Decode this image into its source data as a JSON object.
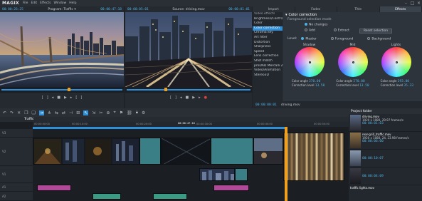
{
  "app": {
    "logo": "MAGIX"
  },
  "menu": [
    "File",
    "Edit",
    "Effects",
    "Window",
    "Help"
  ],
  "window_controls": [
    "–",
    "□",
    "×"
  ],
  "program_monitor": {
    "left_tc": "00:00:26:25",
    "label": "Program: Traffic",
    "dropdown": "▾",
    "right_tc": "00:00:47:18"
  },
  "source_monitor": {
    "left_tc": "00:00:05:01",
    "label": "Source: driving.mov",
    "right_tc": "00:00:01:01"
  },
  "tabs": [
    "Import",
    "Fades",
    "Title",
    "Effects"
  ],
  "video_effects": {
    "header": "Video effects",
    "items": [
      "Brightness/Contrast",
      "Color",
      "Color correction",
      "Chroma key",
      "Art filter",
      "Distortion",
      "Sharpness",
      "Speed",
      "Lens correction",
      "Shot match",
      "proDAD Mercalli 2.0",
      "Video/Animation",
      "Stereo3D"
    ]
  },
  "color_correction": {
    "title": "Color correction",
    "mode_label": "Foreground selection mode",
    "modes": [
      "No changes",
      "Add",
      "Extract"
    ],
    "reset_label": "Reset selection",
    "level_label": "Level:",
    "levels": [
      "Master",
      "Foreground",
      "Background"
    ],
    "wheels": [
      {
        "name": "Shadow",
        "angle_label": "Color angle",
        "angle": "270.00",
        "sat_label": "Correction level",
        "sat": "13.50"
      },
      {
        "name": "Mid",
        "angle_label": "Color angle",
        "angle": "270.00",
        "sat_label": "Correction level",
        "sat": "13.50"
      },
      {
        "name": "Lights",
        "angle_label": "Color angle",
        "angle": "293.00",
        "sat_label": "Correction level",
        "sat": "35.33"
      }
    ]
  },
  "effects_footer": {
    "tc": "00:00:00:01",
    "clip": "driving.mov"
  },
  "timeline": {
    "sequence": "Traffic",
    "ruler": [
      "00:00:00:00",
      "00:00:10:00",
      "00:00:20:00",
      "00:00:30:00",
      "00:00:40:00",
      "00:00:50:00"
    ],
    "position_tc": "00:00:47:18",
    "tracks": [
      "V3",
      "V2",
      "V1",
      "A1",
      "A2",
      "A3"
    ]
  },
  "project_folder": {
    "title": "Project folder",
    "items": [
      {
        "name": "driving.mov",
        "info": "1920 x 1080, 29.97 frames/s",
        "dur": "00:00:01:03"
      },
      {
        "name": "rear-grill_traffic.mov",
        "info": "1920 x 1080, 24, 23.98 frames/s",
        "dur": "00:00:06:00"
      },
      {
        "name": "",
        "info": "",
        "dur": "00:00:10:07"
      },
      {
        "name": "",
        "info": "",
        "dur": "00:00:04:09"
      },
      {
        "name": "traffic lights.mov",
        "info": "",
        "dur": ""
      }
    ]
  },
  "colors": {
    "accent": "#2f8fd8",
    "tc": "#4fb0e6",
    "playhead": "#f0a020"
  }
}
